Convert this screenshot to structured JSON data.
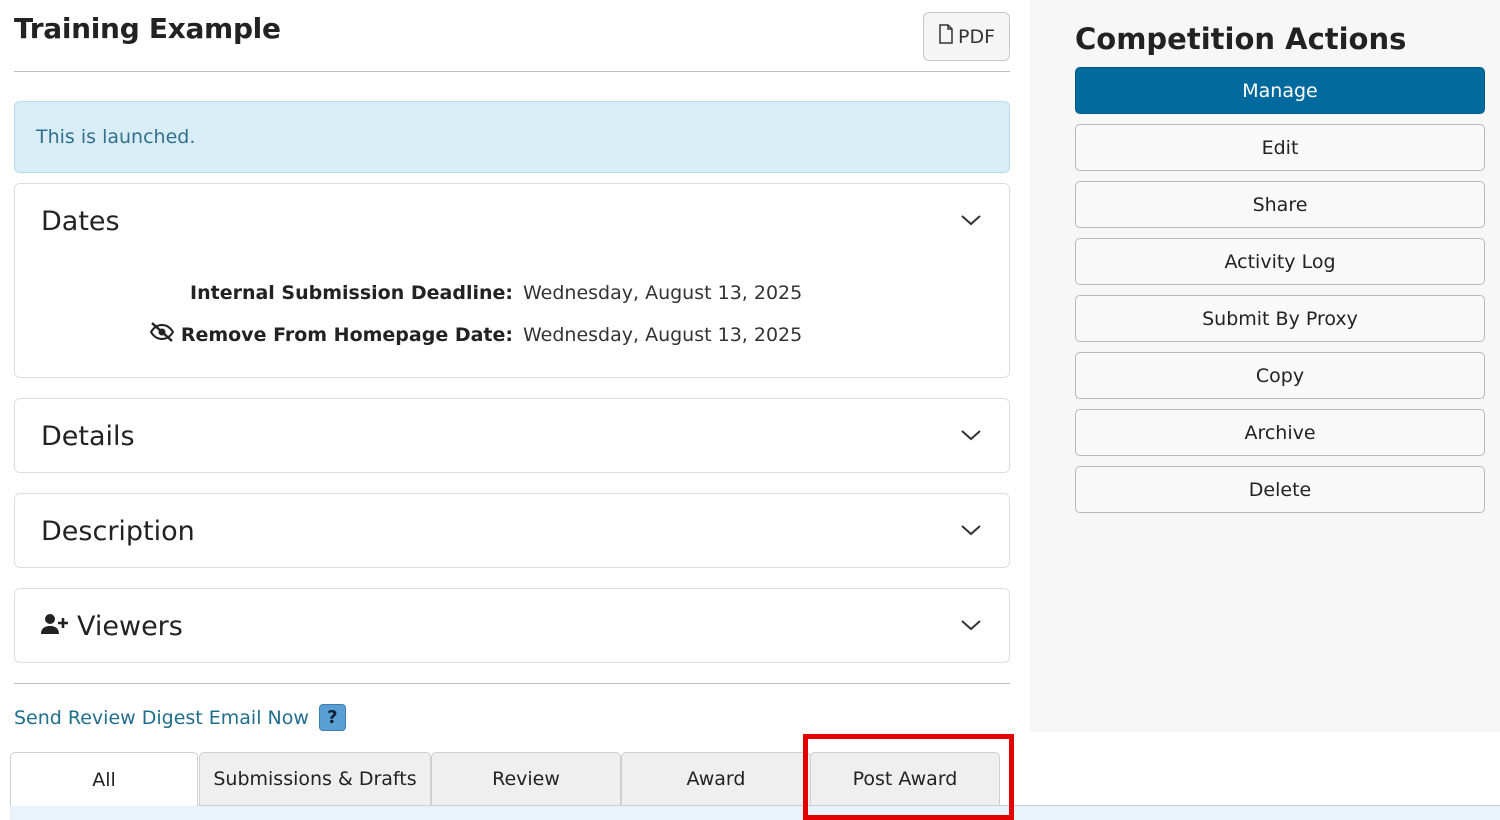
{
  "page": {
    "title": "Training Example",
    "pdf_label": "PDF"
  },
  "alert": {
    "text": "This is launched."
  },
  "panels": {
    "dates": {
      "title": "Dates",
      "rows": [
        {
          "label": "Internal Submission Deadline:",
          "value": "Wednesday, August 13, 2025"
        },
        {
          "label": "Remove From Homepage Date:",
          "value": "Wednesday, August 13, 2025",
          "icon": "eye-slash-icon"
        }
      ]
    },
    "details": {
      "title": "Details"
    },
    "description": {
      "title": "Description"
    },
    "viewers": {
      "title": "Viewers",
      "icon": "user-plus-icon"
    }
  },
  "digest": {
    "link_text": "Send Review Digest Email Now",
    "help_glyph": "?"
  },
  "tabs": [
    {
      "label": "All",
      "active": true
    },
    {
      "label": "Submissions & Drafts",
      "active": false
    },
    {
      "label": "Review",
      "active": false
    },
    {
      "label": "Award",
      "active": false
    },
    {
      "label": "Post Award",
      "active": false
    }
  ],
  "sidebar": {
    "title": "Competition Actions",
    "actions": [
      {
        "label": "Manage",
        "primary": true
      },
      {
        "label": "Edit"
      },
      {
        "label": "Share"
      },
      {
        "label": "Activity Log"
      },
      {
        "label": "Submit By Proxy"
      },
      {
        "label": "Copy"
      },
      {
        "label": "Archive"
      },
      {
        "label": "Delete"
      }
    ]
  },
  "colors": {
    "primary": "#006a9e",
    "alert_bg": "#d9edf7",
    "link": "#1f6e8c",
    "highlight": "#e30000"
  }
}
